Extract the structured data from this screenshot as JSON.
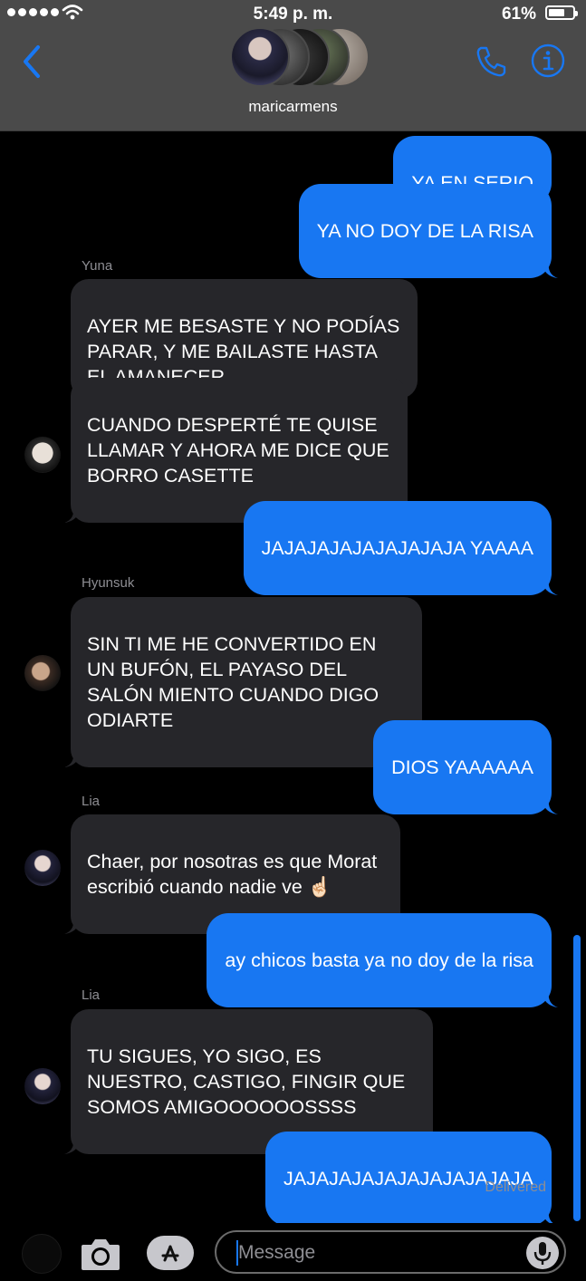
{
  "status_bar": {
    "time": "5:49 p. m.",
    "battery_percent": "61%",
    "battery_level": 0.61
  },
  "header": {
    "group_name": "maricarmens"
  },
  "colors": {
    "outgoing_bubble": "#1877f2",
    "incoming_bubble": "#26262a",
    "header_bg": "#4a4a4a"
  },
  "messages": [
    {
      "direction": "out",
      "text": "YA EN SERIO"
    },
    {
      "direction": "out",
      "text": "YA NO DOY DE LA RISA"
    },
    {
      "direction": "in",
      "sender": "Yuna",
      "text": "AYER ME BESASTE Y NO PODÍAS PARAR, Y ME BAILASTE HASTA EL AMANECER"
    },
    {
      "direction": "in",
      "text": "CUANDO DESPERTÉ TE QUISE LLAMAR Y AHORA ME DICE QUE BORRO CASETTE"
    },
    {
      "direction": "out",
      "text": "JAJAJAJAJAJAJAJAJA YAAAA"
    },
    {
      "direction": "in",
      "sender": "Hyunsuk",
      "text": "SIN TI ME HE CONVERTIDO EN UN BUFÓN, EL PAYASO DEL SALÓN MIENTO CUANDO DIGO ODIARTE"
    },
    {
      "direction": "out",
      "text": "DIOS YAAAAAA"
    },
    {
      "direction": "in",
      "sender": "Lia",
      "text": "Chaer, por nosotras es que Morat escribió cuando nadie ve ☝🏻"
    },
    {
      "direction": "out",
      "text": "ay chicos basta ya no doy de la risa"
    },
    {
      "direction": "in",
      "sender": "Lia",
      "text": "TU SIGUES, YO SIGO, ES NUESTRO, CASTIGO, FINGIR QUE SOMOS AMIGOOOOOOSSSS"
    },
    {
      "direction": "out",
      "text": "JAJAJAJAJAJAJAJAJAJAJA"
    }
  ],
  "delivered_label": "Delivered",
  "composer": {
    "placeholder": "Message"
  },
  "icons": [
    "signal-dots-icon",
    "wifi-icon",
    "battery-icon",
    "back-chevron-icon",
    "phone-icon",
    "info-icon",
    "camera-icon",
    "app-store-icon",
    "microphone-icon"
  ]
}
